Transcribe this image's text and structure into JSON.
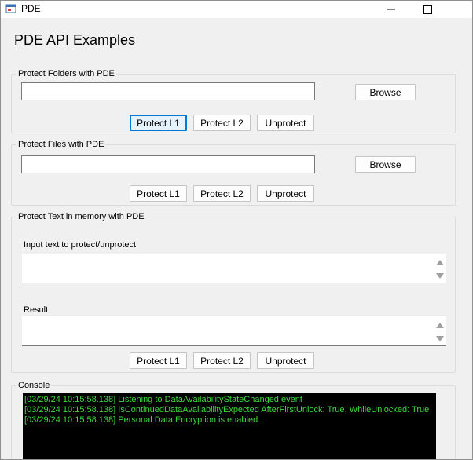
{
  "window": {
    "title": "PDE",
    "icons": {
      "app": "app-icon",
      "minimize": "minimize-icon",
      "maximize": "maximize-icon"
    }
  },
  "main": {
    "heading": "PDE API Examples"
  },
  "folders": {
    "group_label": "Protect Folders with PDE",
    "path_value": "",
    "browse_label": "Browse",
    "protect_l1": "Protect L1",
    "protect_l2": "Protect L2",
    "unprotect": "Unprotect"
  },
  "files": {
    "group_label": "Protect Files with PDE",
    "path_value": "",
    "browse_label": "Browse",
    "protect_l1": "Protect L1",
    "protect_l2": "Protect L2",
    "unprotect": "Unprotect"
  },
  "text": {
    "group_label": "Protect Text in memory with PDE",
    "input_label": "Input text to protect/unprotect",
    "input_value": "",
    "result_label": "Result",
    "result_value": "",
    "protect_l1": "Protect L1",
    "protect_l2": "Protect L2",
    "unprotect": "Unprotect"
  },
  "console": {
    "group_label": "Console",
    "lines": [
      "[03/29/24 10:15:58.138] Listening to DataAvailabilityStateChanged event",
      "[03/29/24 10:15:58.138] IsContinuedDataAvailabilityExpected AfterFirstUnlock: True, WhileUnlocked: True",
      "[03/29/24 10:15:58.138] Personal Data Encryption is enabled."
    ],
    "text_color": "#3fd83f"
  }
}
